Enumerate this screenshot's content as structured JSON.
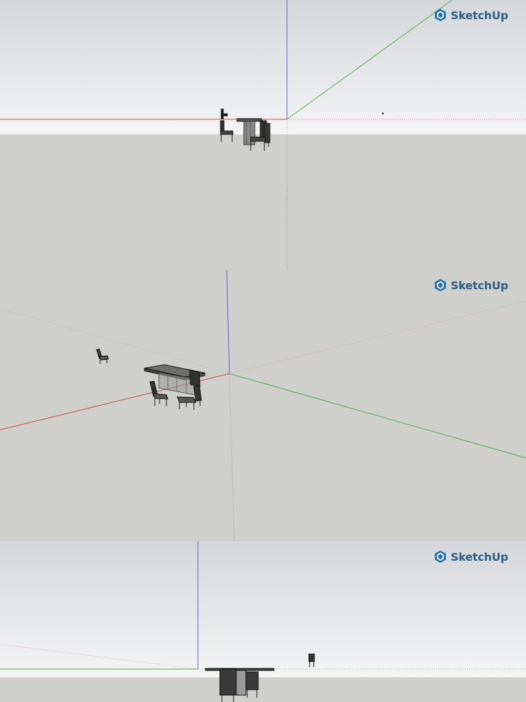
{
  "brand": {
    "name": "SketchUp",
    "icon": "sketchup-logo-icon",
    "color": "#1f6fb2"
  },
  "viewports": [
    {
      "name": "top-view",
      "view": "eye-level"
    },
    {
      "name": "perspective-view",
      "view": "aerial perspective"
    },
    {
      "name": "side-view",
      "view": "eye-level"
    }
  ],
  "axis_colors": {
    "red": "#d04545",
    "green": "#4cb04c",
    "blue": "#4a4ad0"
  },
  "scene_colors": {
    "sky_top": "#d5d8db",
    "sky_bottom": "#f3f3f4",
    "ground": "#cfcfcb"
  },
  "model": {
    "objects": [
      "dining-table",
      "dining-chair"
    ]
  }
}
